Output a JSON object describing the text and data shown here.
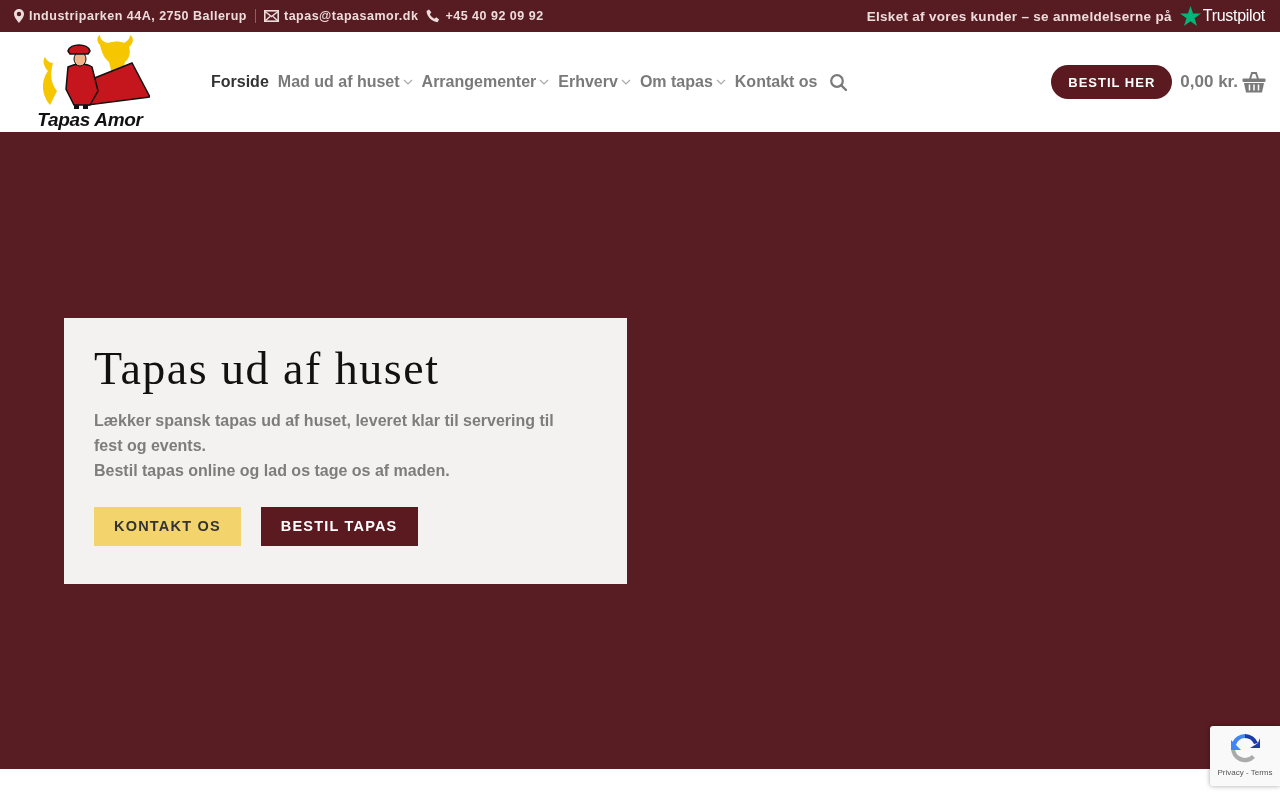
{
  "top_bar": {
    "contacts": [
      {
        "kind": "address",
        "text": "Industriparken 44A, 2750 Ballerup"
      },
      {
        "kind": "email",
        "text": "tapas@tapasamor.dk"
      },
      {
        "kind": "phone",
        "text": "+45 40 92 09 92"
      }
    ],
    "review_text": "Elsket af vores kunder – se anmeldelserne på",
    "review_brand": "Trustpilot"
  },
  "header": {
    "logo_text": "Tapas Amor",
    "nav": [
      {
        "label": "Forside",
        "selected": true,
        "dropdown": false
      },
      {
        "label": "Mad ud af huset",
        "selected": false,
        "dropdown": true
      },
      {
        "label": "Arrangementer",
        "selected": false,
        "dropdown": true
      },
      {
        "label": "Erhverv",
        "selected": false,
        "dropdown": true
      },
      {
        "label": "Om tapas",
        "selected": false,
        "dropdown": true
      },
      {
        "label": "Kontakt os",
        "selected": false,
        "dropdown": false
      }
    ],
    "order_button": "BESTIL HER",
    "cart_total": "0,00 kr."
  },
  "hero": {
    "title": "Tapas ud af huset",
    "lines": [
      "Lækker spansk tapas ud af huset, leveret klar til servering til fest og events.",
      "Bestil tapas online og lad os tage os af maden."
    ],
    "buttons": [
      {
        "label": "KONTAKT OS",
        "kind": "secondary"
      },
      {
        "label": "BESTIL TAPAS",
        "kind": "primary"
      }
    ]
  },
  "recaptcha": {
    "links": "Privacy - Terms"
  }
}
